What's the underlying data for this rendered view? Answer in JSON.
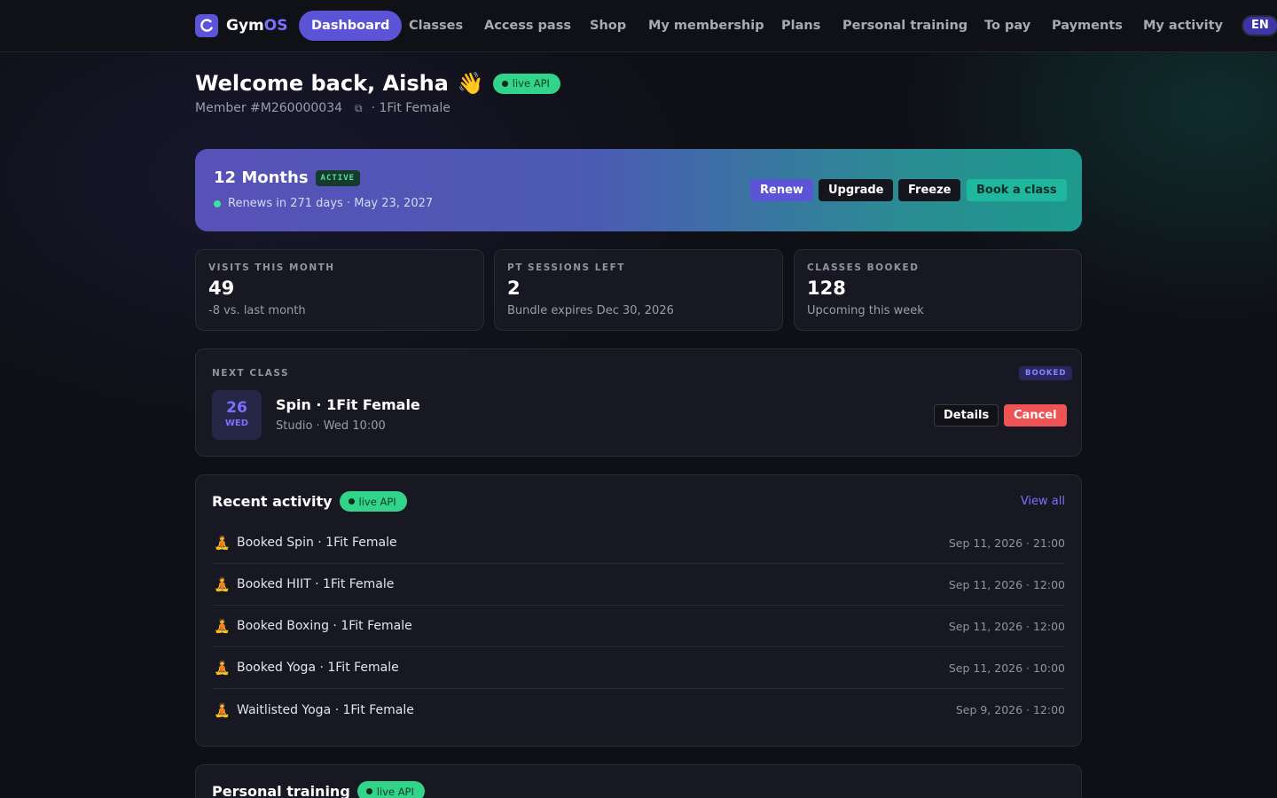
{
  "nav": {
    "brand_main": "Gym",
    "brand_accent": "OS",
    "items": [
      "Dashboard",
      "Classes",
      "Access pass",
      "Shop",
      "My membership",
      "Plans",
      "Personal training",
      "To pay",
      "Payments",
      "My activity"
    ],
    "active_index": 0,
    "language": "EN"
  },
  "header": {
    "welcome": "Welcome back, Aisha",
    "wave_emoji": "👋",
    "live_label": "live API",
    "member_id": "Member #M260000034",
    "location": "· 1Fit Female"
  },
  "membership": {
    "plan": "12 Months",
    "status": "ACTIVE",
    "renew_text": "Renews in 271 days · May 23, 2027",
    "buttons": {
      "renew": "Renew",
      "upgrade": "Upgrade",
      "freeze": "Freeze",
      "book": "Book a class"
    }
  },
  "stats": [
    {
      "label": "VISITS THIS MONTH",
      "value": "49",
      "sub": "-8 vs. last month"
    },
    {
      "label": "PT SESSIONS LEFT",
      "value": "2",
      "sub": "Bundle expires Dec 30, 2026"
    },
    {
      "label": "CLASSES BOOKED",
      "value": "128",
      "sub": "Upcoming this week"
    }
  ],
  "next_class": {
    "label": "NEXT CLASS",
    "badge": "BOOKED",
    "day": "26",
    "weekday": "WED",
    "title": "Spin · 1Fit Female",
    "subtitle": "Studio · Wed 10:00",
    "details_label": "Details",
    "cancel_label": "Cancel"
  },
  "recent_activity": {
    "title": "Recent activity",
    "live_label": "live API",
    "view_all": "View all",
    "items": [
      {
        "icon": "🧘",
        "text": "Booked Spin · 1Fit Female",
        "time": "Sep 11, 2026 · 21:00"
      },
      {
        "icon": "🧘",
        "text": "Booked HIIT · 1Fit Female",
        "time": "Sep 11, 2026 · 12:00"
      },
      {
        "icon": "🧘",
        "text": "Booked Boxing · 1Fit Female",
        "time": "Sep 11, 2026 · 12:00"
      },
      {
        "icon": "🧘",
        "text": "Booked Yoga · 1Fit Female",
        "time": "Sep 11, 2026 · 10:00"
      },
      {
        "icon": "🧘",
        "text": "Waitlisted Yoga · 1Fit Female",
        "time": "Sep 9, 2026 · 12:00"
      }
    ]
  },
  "personal_training": {
    "title": "Personal training",
    "live_label": "live API"
  },
  "colors": {
    "accent": "#5b54d6",
    "live_green": "#32d48a",
    "danger": "#ef5454",
    "teal": "#1fb8a0"
  }
}
